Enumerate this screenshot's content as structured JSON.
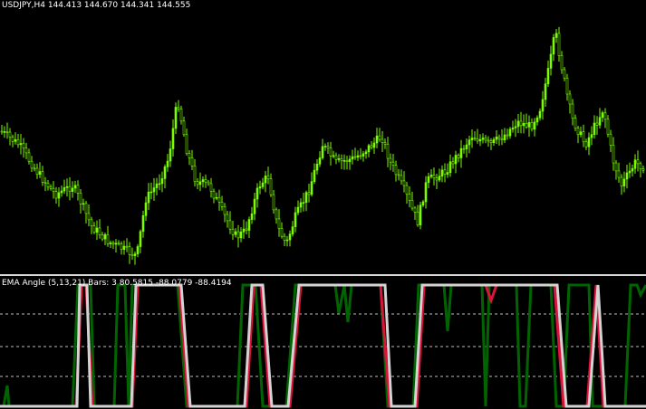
{
  "chart": {
    "symbol_label": "USDJPY,H4",
    "ohlc_label": "144.413 144.670 144.341 144.555",
    "candle_color": "#7CFC00",
    "background": "#000000"
  },
  "indicator": {
    "name_label": "EMA Angle (5,13,21) Bars: 3",
    "values_label": "80.5815 -88.0779 -88.4194",
    "level_line_color": "#c8c8c8",
    "series_colors": [
      "#dc143c",
      "#006400",
      "#d3d3d3"
    ]
  }
}
